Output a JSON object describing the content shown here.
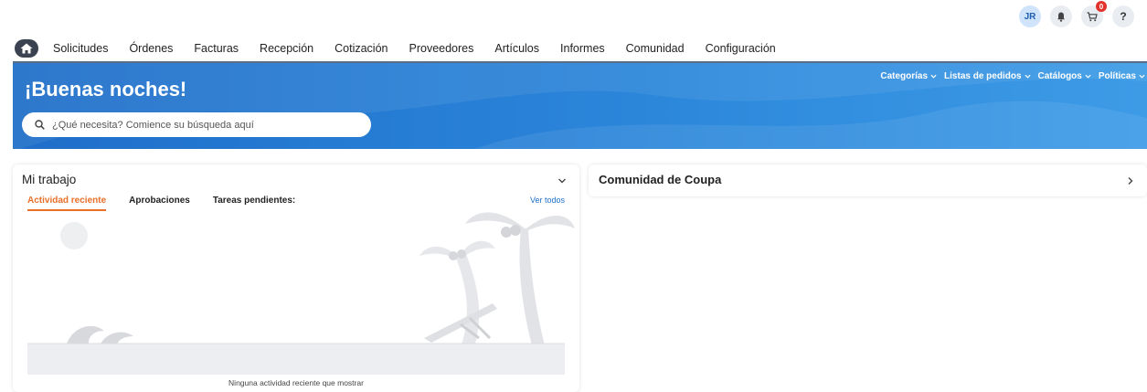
{
  "header": {
    "user_initials": "JR",
    "cart_count": "0",
    "help_label": "?",
    "icons": {
      "notifications": "bell-icon",
      "cart": "cart-icon"
    }
  },
  "nav": {
    "home_icon": "home-icon",
    "items": [
      "Solicitudes",
      "Órdenes",
      "Facturas",
      "Recepción",
      "Cotización",
      "Proveedores",
      "Artículos",
      "Informes",
      "Comunidad",
      "Configuración"
    ]
  },
  "hero": {
    "greeting": "¡Buenas noches!",
    "search_placeholder": "¿Qué necesita? Comience su búsqueda aquí",
    "menus": [
      "Categorías",
      "Listas de pedidos",
      "Catálogos",
      "Políticas"
    ]
  },
  "my_work": {
    "title": "Mi trabajo",
    "tabs": [
      "Actividad reciente",
      "Aprobaciones",
      "Tareas pendientes:"
    ],
    "active_tab": "Actividad reciente",
    "view_all": "Ver todos",
    "empty_message": "Ninguna actividad reciente que mostrar"
  },
  "community": {
    "title": "Comunidad de Coupa"
  },
  "colors": {
    "brand_blue": "#1f6ec9",
    "accent_orange": "#e8702a",
    "badge_red": "#e3322b"
  }
}
